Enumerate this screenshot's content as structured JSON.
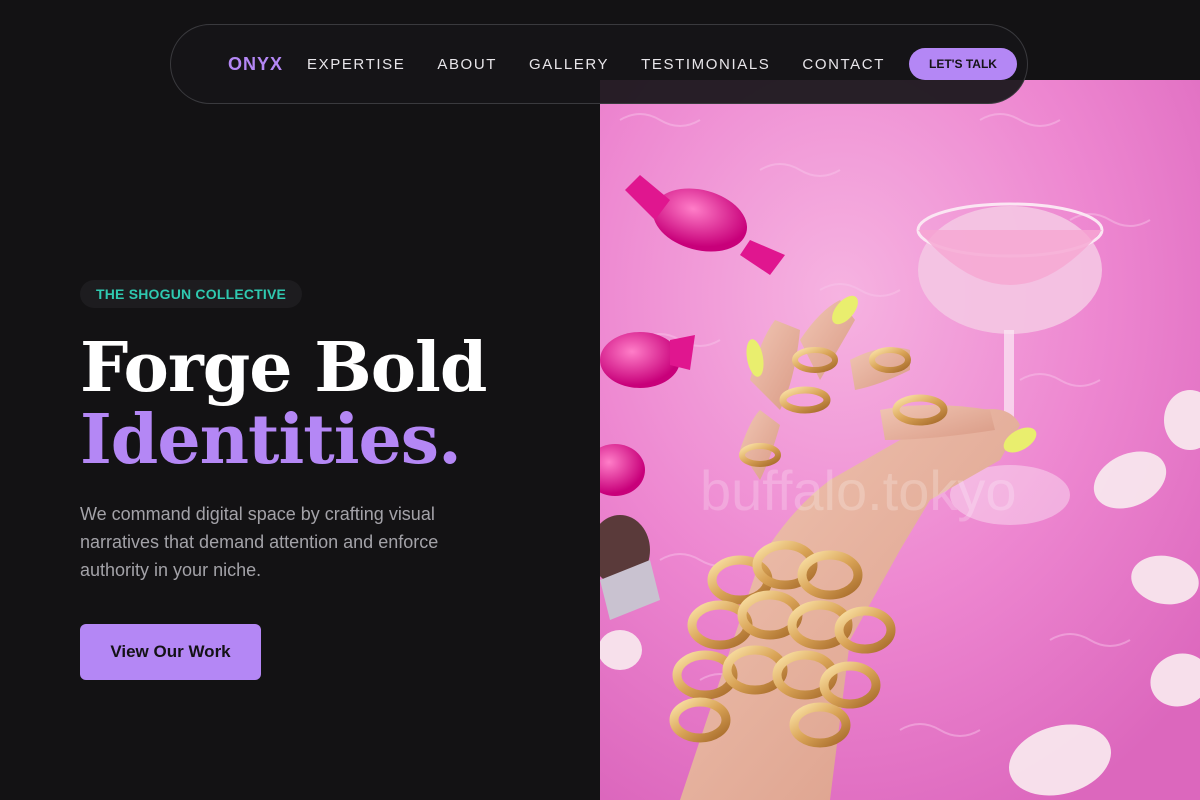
{
  "nav": {
    "brand": "ONYX",
    "links": [
      "EXPERTISE",
      "ABOUT",
      "GALLERY",
      "TESTIMONIALS",
      "CONTACT"
    ],
    "cta_label": "LET'S TALK"
  },
  "hero": {
    "badge": "THE SHOGUN COLLECTIVE",
    "headline_line1": "Forge Bold",
    "headline_line2": "Identities.",
    "description": "We command digital space by crafting visual narratives that demand attention and enforce authority in your niche.",
    "button_label": "View Our Work",
    "image_watermark": "buffalo.tokyo"
  },
  "colors": {
    "accent": "#b487f5",
    "badge_text": "#2fc9b0",
    "background": "#131214",
    "image_pink": "#ee7fcf"
  }
}
